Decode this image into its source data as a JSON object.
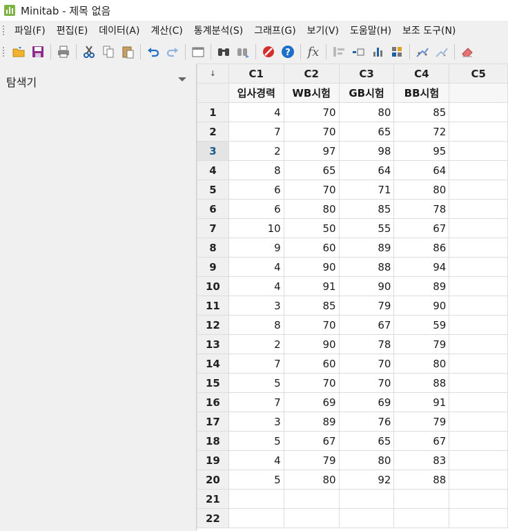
{
  "window": {
    "title": "Minitab - 제목 없음"
  },
  "menu": [
    "파일(F)",
    "편집(E)",
    "데이터(A)",
    "계산(C)",
    "통계분석(S)",
    "그래프(G)",
    "보기(V)",
    "도움말(H)",
    "보조 도구(N)"
  ],
  "toolbar": {
    "buttons": [
      "open-icon",
      "save-icon",
      "print-icon",
      "cut-icon",
      "copy-icon",
      "paste-icon",
      "undo-icon",
      "redo-icon",
      "window-icon",
      "find-icon",
      "find-next-icon",
      "cancel-icon",
      "help-icon",
      "formula-icon",
      "tool-1-icon",
      "tool-2-icon",
      "tool-3-icon",
      "tool-4-icon",
      "tool-5-icon",
      "tool-6-icon",
      "eraser-icon"
    ],
    "fx_label": "fx"
  },
  "explorer": {
    "title": "탐색기"
  },
  "worksheet": {
    "corner": "↓",
    "columns": [
      "C1",
      "C2",
      "C3",
      "C4",
      "C5"
    ],
    "names": [
      "입사경력",
      "WB시험",
      "GB시험",
      "BB시험",
      ""
    ],
    "active_row": 3,
    "row_numbers": [
      "1",
      "2",
      "3",
      "4",
      "5",
      "6",
      "7",
      "8",
      "9",
      "10",
      "11",
      "12",
      "13",
      "14",
      "15",
      "16",
      "17",
      "18",
      "19",
      "20",
      "21",
      "22"
    ],
    "rows": [
      [
        "4",
        "70",
        "80",
        "85"
      ],
      [
        "7",
        "70",
        "65",
        "72"
      ],
      [
        "2",
        "97",
        "98",
        "95"
      ],
      [
        "8",
        "65",
        "64",
        "64"
      ],
      [
        "6",
        "70",
        "71",
        "80"
      ],
      [
        "6",
        "80",
        "85",
        "78"
      ],
      [
        "10",
        "50",
        "55",
        "67"
      ],
      [
        "9",
        "60",
        "89",
        "86"
      ],
      [
        "4",
        "90",
        "88",
        "94"
      ],
      [
        "4",
        "91",
        "90",
        "89"
      ],
      [
        "3",
        "85",
        "79",
        "90"
      ],
      [
        "8",
        "70",
        "67",
        "59"
      ],
      [
        "2",
        "90",
        "78",
        "79"
      ],
      [
        "7",
        "60",
        "70",
        "80"
      ],
      [
        "5",
        "70",
        "70",
        "88"
      ],
      [
        "7",
        "69",
        "69",
        "91"
      ],
      [
        "3",
        "89",
        "76",
        "79"
      ],
      [
        "5",
        "67",
        "65",
        "67"
      ],
      [
        "4",
        "79",
        "80",
        "83"
      ],
      [
        "5",
        "80",
        "92",
        "88"
      ]
    ]
  }
}
